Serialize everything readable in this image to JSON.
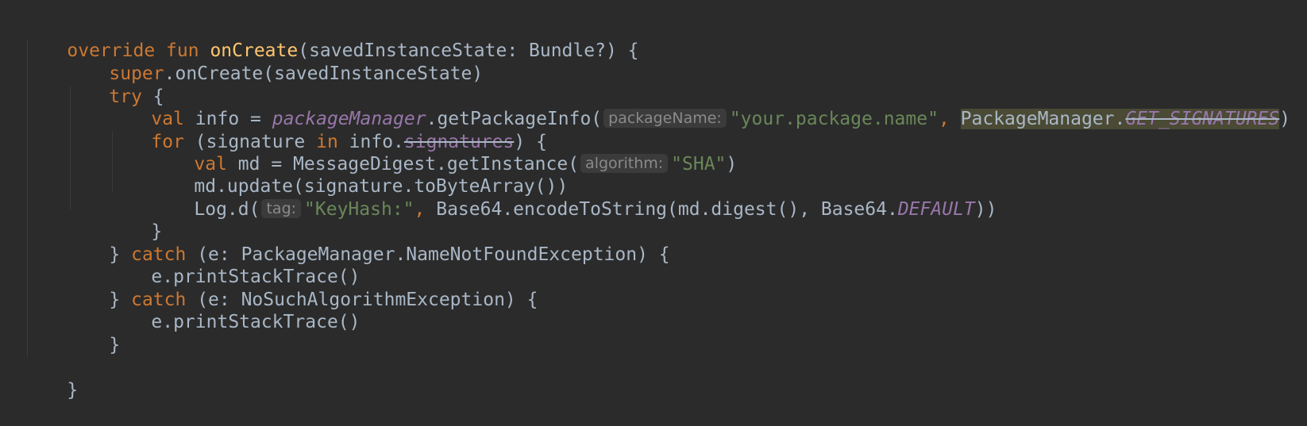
{
  "code": {
    "line1": {
      "kw_override": "override",
      "kw_fun": "fun",
      "fn_name": "onCreate",
      "params": "(savedInstanceState: Bundle?) {"
    },
    "line2": {
      "kw_super": "super",
      "rest": ".onCreate(savedInstanceState)"
    },
    "line3": {
      "kw_try": "try",
      "rest": " {"
    },
    "line4": {
      "kw_val": "val",
      "info_assign": " info = ",
      "package_manager": "packageManager",
      "get_package_info": ".getPackageInfo(",
      "hint_package_name": "packageName:",
      "string_package": "\"your.package.name\"",
      "comma": ", ",
      "pm_class": "PackageManager.",
      "get_signatures": "GET_SIGNATURES",
      "close": ")"
    },
    "line5": {
      "kw_for": "for",
      "open": " (signature ",
      "kw_in": "in",
      "info_dot": " info.",
      "signatures": "signatures",
      "close": ") {"
    },
    "line6": {
      "kw_val": "val",
      "md_assign": " md = MessageDigest.getInstance(",
      "hint_algorithm": "algorithm:",
      "string_sha": "\"SHA\"",
      "close": ")"
    },
    "line7": {
      "text": "md.update(signature.toByteArray())"
    },
    "line8": {
      "log_d": "Log.d(",
      "hint_tag": "tag:",
      "string_keyhash": "\"KeyHash:\"",
      "comma": ", ",
      "encode": "Base64.encodeToString(md.digest(), Base64.",
      "default_const": "DEFAULT",
      "close": "))"
    },
    "line9": {
      "text": "}"
    },
    "line10": {
      "brace": "} ",
      "kw_catch": "catch",
      "rest": " (e: PackageManager.NameNotFoundException) {"
    },
    "line11": {
      "text": "e.printStackTrace()"
    },
    "line12": {
      "brace": "} ",
      "kw_catch": "catch",
      "rest": " (e: NoSuchAlgorithmException) {"
    },
    "line13": {
      "text": "e.printStackTrace()"
    },
    "line14": {
      "text": "}"
    },
    "line16": {
      "text": "}"
    }
  },
  "colors": {
    "background": "#2b2b2b",
    "default_text": "#a9b7c6",
    "keyword": "#cc7832",
    "function_declaration": "#ffc66d",
    "string": "#6a8759",
    "property_constant": "#9876aa",
    "inlay_hint_bg": "#3b3b3b",
    "inlay_hint_text": "#8a8a8a",
    "selection_highlight": "#4a4a35"
  }
}
